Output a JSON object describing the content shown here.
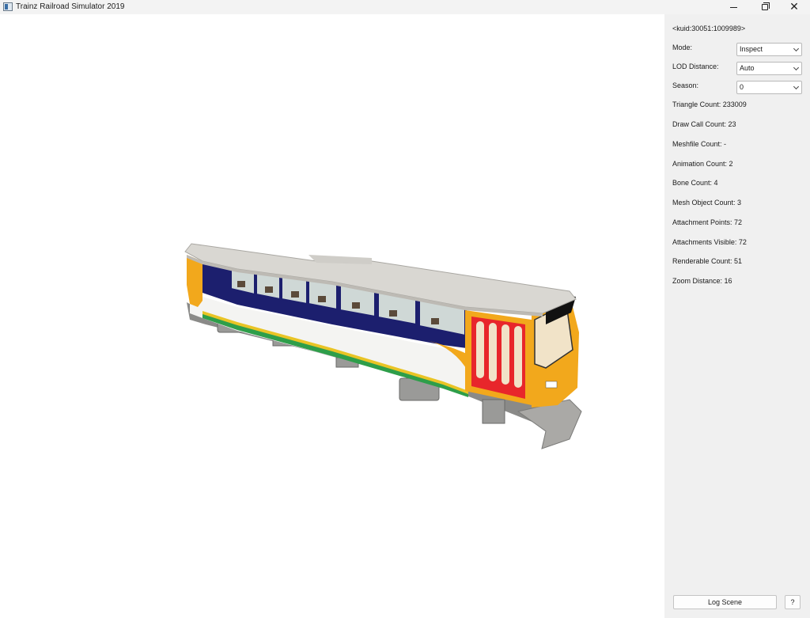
{
  "window": {
    "title": "Trainz Railroad Simulator 2019",
    "app_icon": "app-window-icon"
  },
  "panel": {
    "kuid": "<kuid:30051:1009989>",
    "mode": {
      "label": "Mode:",
      "value": "Inspect"
    },
    "lod": {
      "label": "LOD Distance:",
      "value": "Auto"
    },
    "season": {
      "label": "Season:",
      "value": "0"
    },
    "stats": [
      "Triangle Count: 233009",
      "Draw Call Count: 23",
      "Meshfile Count: -",
      "Animation Count: 2",
      "Bone Count: 4",
      "Mesh Object Count: 3",
      "Attachment Points: 72",
      "Attachments Visible: 72",
      "Renderable Count: 51",
      "Zoom Distance: 16"
    ],
    "log_button": "Log Scene",
    "help_button": "?"
  },
  "colors": {
    "livery_yellow": "#f2a81c",
    "livery_blue": "#1c1f6e",
    "livery_white": "#f4f4f2",
    "door_red": "#e8262b",
    "stripe_green": "#2e9e4a",
    "roof_grey": "#d9d7d2"
  }
}
